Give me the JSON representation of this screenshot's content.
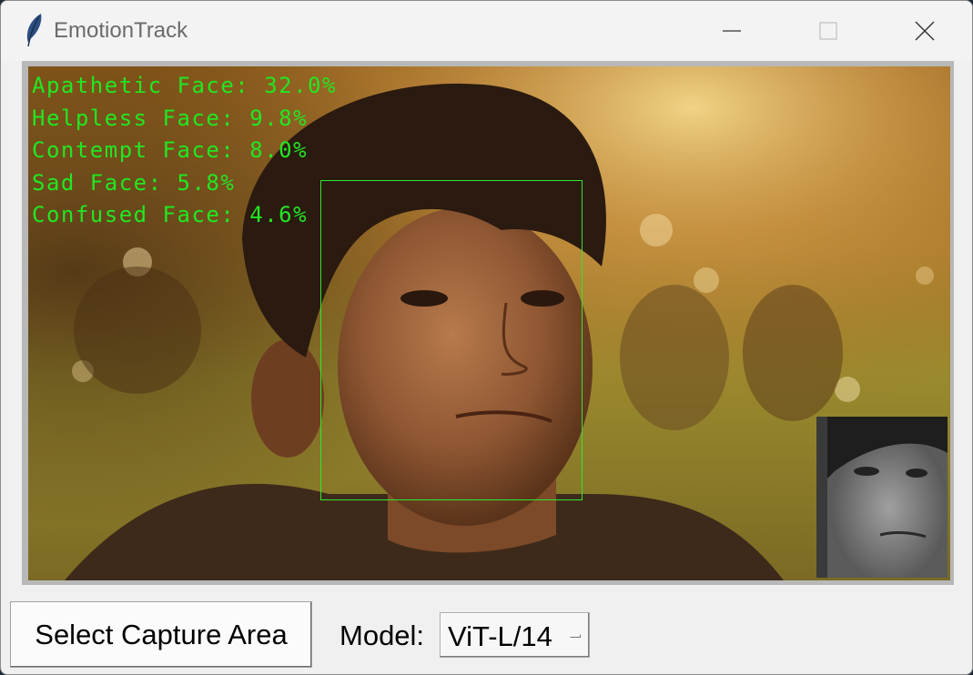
{
  "window": {
    "title": "EmotionTrack",
    "app_icon": "feather-icon",
    "controls": [
      "minimize-icon",
      "maximize-icon",
      "close-icon"
    ]
  },
  "capture_view": {
    "detections": [
      {
        "label": "Apathetic Face: 32.0%"
      },
      {
        "label": "Helpless Face: 9.8%"
      },
      {
        "label": "Contempt Face: 8.0%"
      },
      {
        "label": "Sad Face: 5.8%"
      },
      {
        "label": "Confused Face: 4.6%"
      }
    ],
    "overlay_color": "#22e622"
  },
  "controls": {
    "capture_button": "Select Capture Area",
    "model_label": "Model:",
    "model_value": "ViT-L/14"
  }
}
